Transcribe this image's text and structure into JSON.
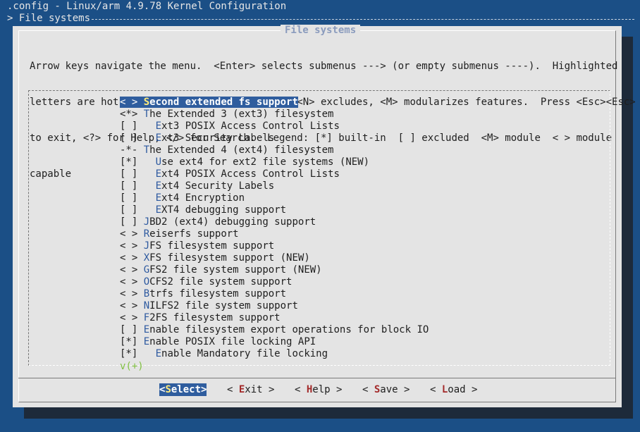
{
  "window": {
    "title": ".config - Linux/arm 4.9.78 Kernel Configuration",
    "breadcrumb": "> File systems"
  },
  "dialog": {
    "title": "File systems",
    "help_lines": [
      "Arrow keys navigate the menu.  <Enter> selects submenus ---> (or empty submenus ----).  Highlighted",
      "letters are hotkeys.  Pressing <Y> includes, <N> excludes, <M> modularizes features.  Press <Esc><Esc>",
      "to exit, <?> for Help, </> for Search.  Legend: [*] built-in  [ ] excluded  <M> module  < > module",
      "capable"
    ]
  },
  "menu": {
    "items": [
      {
        "state": "< >",
        "indent": "",
        "hotkey": "S",
        "rest": "econd extended fs support"
      },
      {
        "state": "<*>",
        "indent": "",
        "hotkey": "T",
        "rest": "he Extended 3 (ext3) filesystem"
      },
      {
        "state": "[ ]",
        "indent": "  ",
        "hotkey": "E",
        "rest": "xt3 POSIX Access Control Lists"
      },
      {
        "state": "[ ]",
        "indent": "  ",
        "hotkey": "E",
        "rest": "xt3 Security Labels"
      },
      {
        "state": "-*-",
        "indent": "",
        "hotkey": "T",
        "rest": "he Extended 4 (ext4) filesystem"
      },
      {
        "state": "[*]",
        "indent": "  ",
        "hotkey": "U",
        "rest": "se ext4 for ext2 file systems (NEW)"
      },
      {
        "state": "[ ]",
        "indent": "  ",
        "hotkey": "E",
        "rest": "xt4 POSIX Access Control Lists"
      },
      {
        "state": "[ ]",
        "indent": "  ",
        "hotkey": "E",
        "rest": "xt4 Security Labels"
      },
      {
        "state": "[ ]",
        "indent": "  ",
        "hotkey": "E",
        "rest": "xt4 Encryption"
      },
      {
        "state": "[ ]",
        "indent": "  ",
        "hotkey": "E",
        "rest": "XT4 debugging support"
      },
      {
        "state": "[ ]",
        "indent": "",
        "hotkey": "J",
        "rest": "BD2 (ext4) debugging support"
      },
      {
        "state": "< >",
        "indent": "",
        "hotkey": "R",
        "rest": "eiserfs support"
      },
      {
        "state": "< >",
        "indent": "",
        "hotkey": "J",
        "rest": "FS filesystem support"
      },
      {
        "state": "< >",
        "indent": "",
        "hotkey": "X",
        "rest": "FS filesystem support (NEW)"
      },
      {
        "state": "< >",
        "indent": "",
        "hotkey": "G",
        "rest": "FS2 file system support (NEW)"
      },
      {
        "state": "< >",
        "indent": "",
        "hotkey": "O",
        "rest": "CFS2 file system support"
      },
      {
        "state": "< >",
        "indent": "",
        "hotkey": "B",
        "rest": "trfs filesystem support"
      },
      {
        "state": "< >",
        "indent": "",
        "hotkey": "N",
        "rest": "ILFS2 file system support"
      },
      {
        "state": "< >",
        "indent": "",
        "hotkey": "F",
        "rest": "2FS filesystem support"
      },
      {
        "state": "[ ]",
        "indent": "",
        "hotkey": "E",
        "rest": "nable filesystem export operations for block IO"
      },
      {
        "state": "[*]",
        "indent": "",
        "hotkey": "E",
        "rest": "nable POSIX file locking API"
      },
      {
        "state": "[*]",
        "indent": "  ",
        "hotkey": "E",
        "rest": "nable Mandatory file locking"
      }
    ],
    "scroll_indicator": "v(+)"
  },
  "buttons": {
    "select": {
      "open": "<",
      "hotkey": "S",
      "rest": "elect",
      "close": ">"
    },
    "exit": {
      "open": "< ",
      "hotkey": "E",
      "rest": "xit",
      "close": " >"
    },
    "help": {
      "open": "< ",
      "hotkey": "H",
      "rest": "elp",
      "close": " >"
    },
    "save": {
      "open": "< ",
      "hotkey": "S",
      "rest": "ave",
      "close": " >"
    },
    "load": {
      "open": "< ",
      "hotkey": "L",
      "rest": "oad",
      "close": " >"
    }
  },
  "colors": {
    "background": "#1b4f86",
    "dialog": "#e4e4e4",
    "highlight": "#2f5d9e",
    "hotkey": "#2e5aa0",
    "button_hotkey": "#a32a2a",
    "scroll_indicator": "#7fbf3f"
  }
}
